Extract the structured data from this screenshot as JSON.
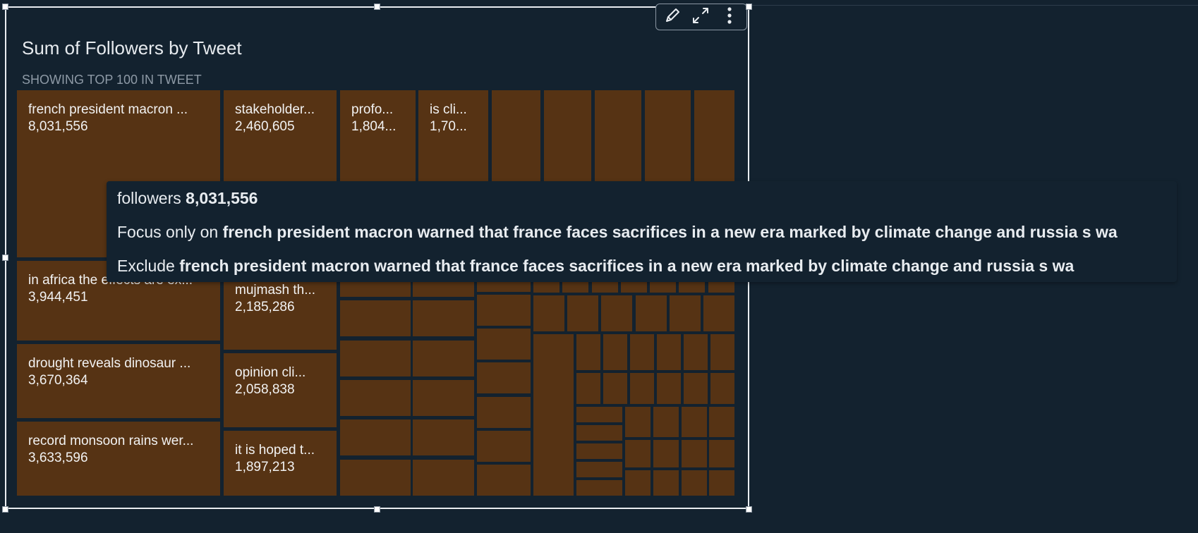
{
  "visual": {
    "title": "Sum of Followers by Tweet",
    "subtitle": "SHOWING TOP 100 IN TWEET",
    "toolbar": {
      "icons": [
        "pencil-icon",
        "expand-icon",
        "more-vertical-icon"
      ]
    }
  },
  "chart_data": {
    "type": "treemap",
    "title": "Sum of Followers by Tweet",
    "subtitle": "SHOWING TOP 100 IN TWEET",
    "measure": "followers",
    "tile_color": "#563314",
    "labeled_tiles": [
      {
        "label": "french president macron ...",
        "value": 8031556,
        "display": "8,031,556"
      },
      {
        "label": "stakeholder...",
        "value": 2460605,
        "display": "2,460,605"
      },
      {
        "label": "profo...",
        "display": "1,804..."
      },
      {
        "label": "is cli...",
        "display": "1,70..."
      },
      {
        "label": "in africa the effects are ex...",
        "value": 3944451,
        "display": "3,944,451"
      },
      {
        "label": "mujmash th...",
        "value": 2185286,
        "display": "2,185,286"
      },
      {
        "label": "drought reveals dinosaur ...",
        "value": 3670364,
        "display": "3,670,364"
      },
      {
        "label": "opinion cli...",
        "value": 2058838,
        "display": "2,058,838"
      },
      {
        "label": "record monsoon rains wer...",
        "value": 3633596,
        "display": "3,633,596"
      },
      {
        "label": "it is hoped t...",
        "value": 1897213,
        "display": "1,897,213"
      }
    ]
  },
  "tooltip": {
    "measure_label": "followers",
    "measure_value": "8,031,556",
    "focus_prefix": "Focus only on",
    "exclude_prefix": "Exclude",
    "tweet": "french president macron warned that france faces sacrifices in a new era marked by climate change and russia s wa"
  },
  "colors": {
    "background": "#13222f",
    "tile": "#563314",
    "tooltip_bg": "#13222f",
    "selection_border": "#e9edf1"
  }
}
